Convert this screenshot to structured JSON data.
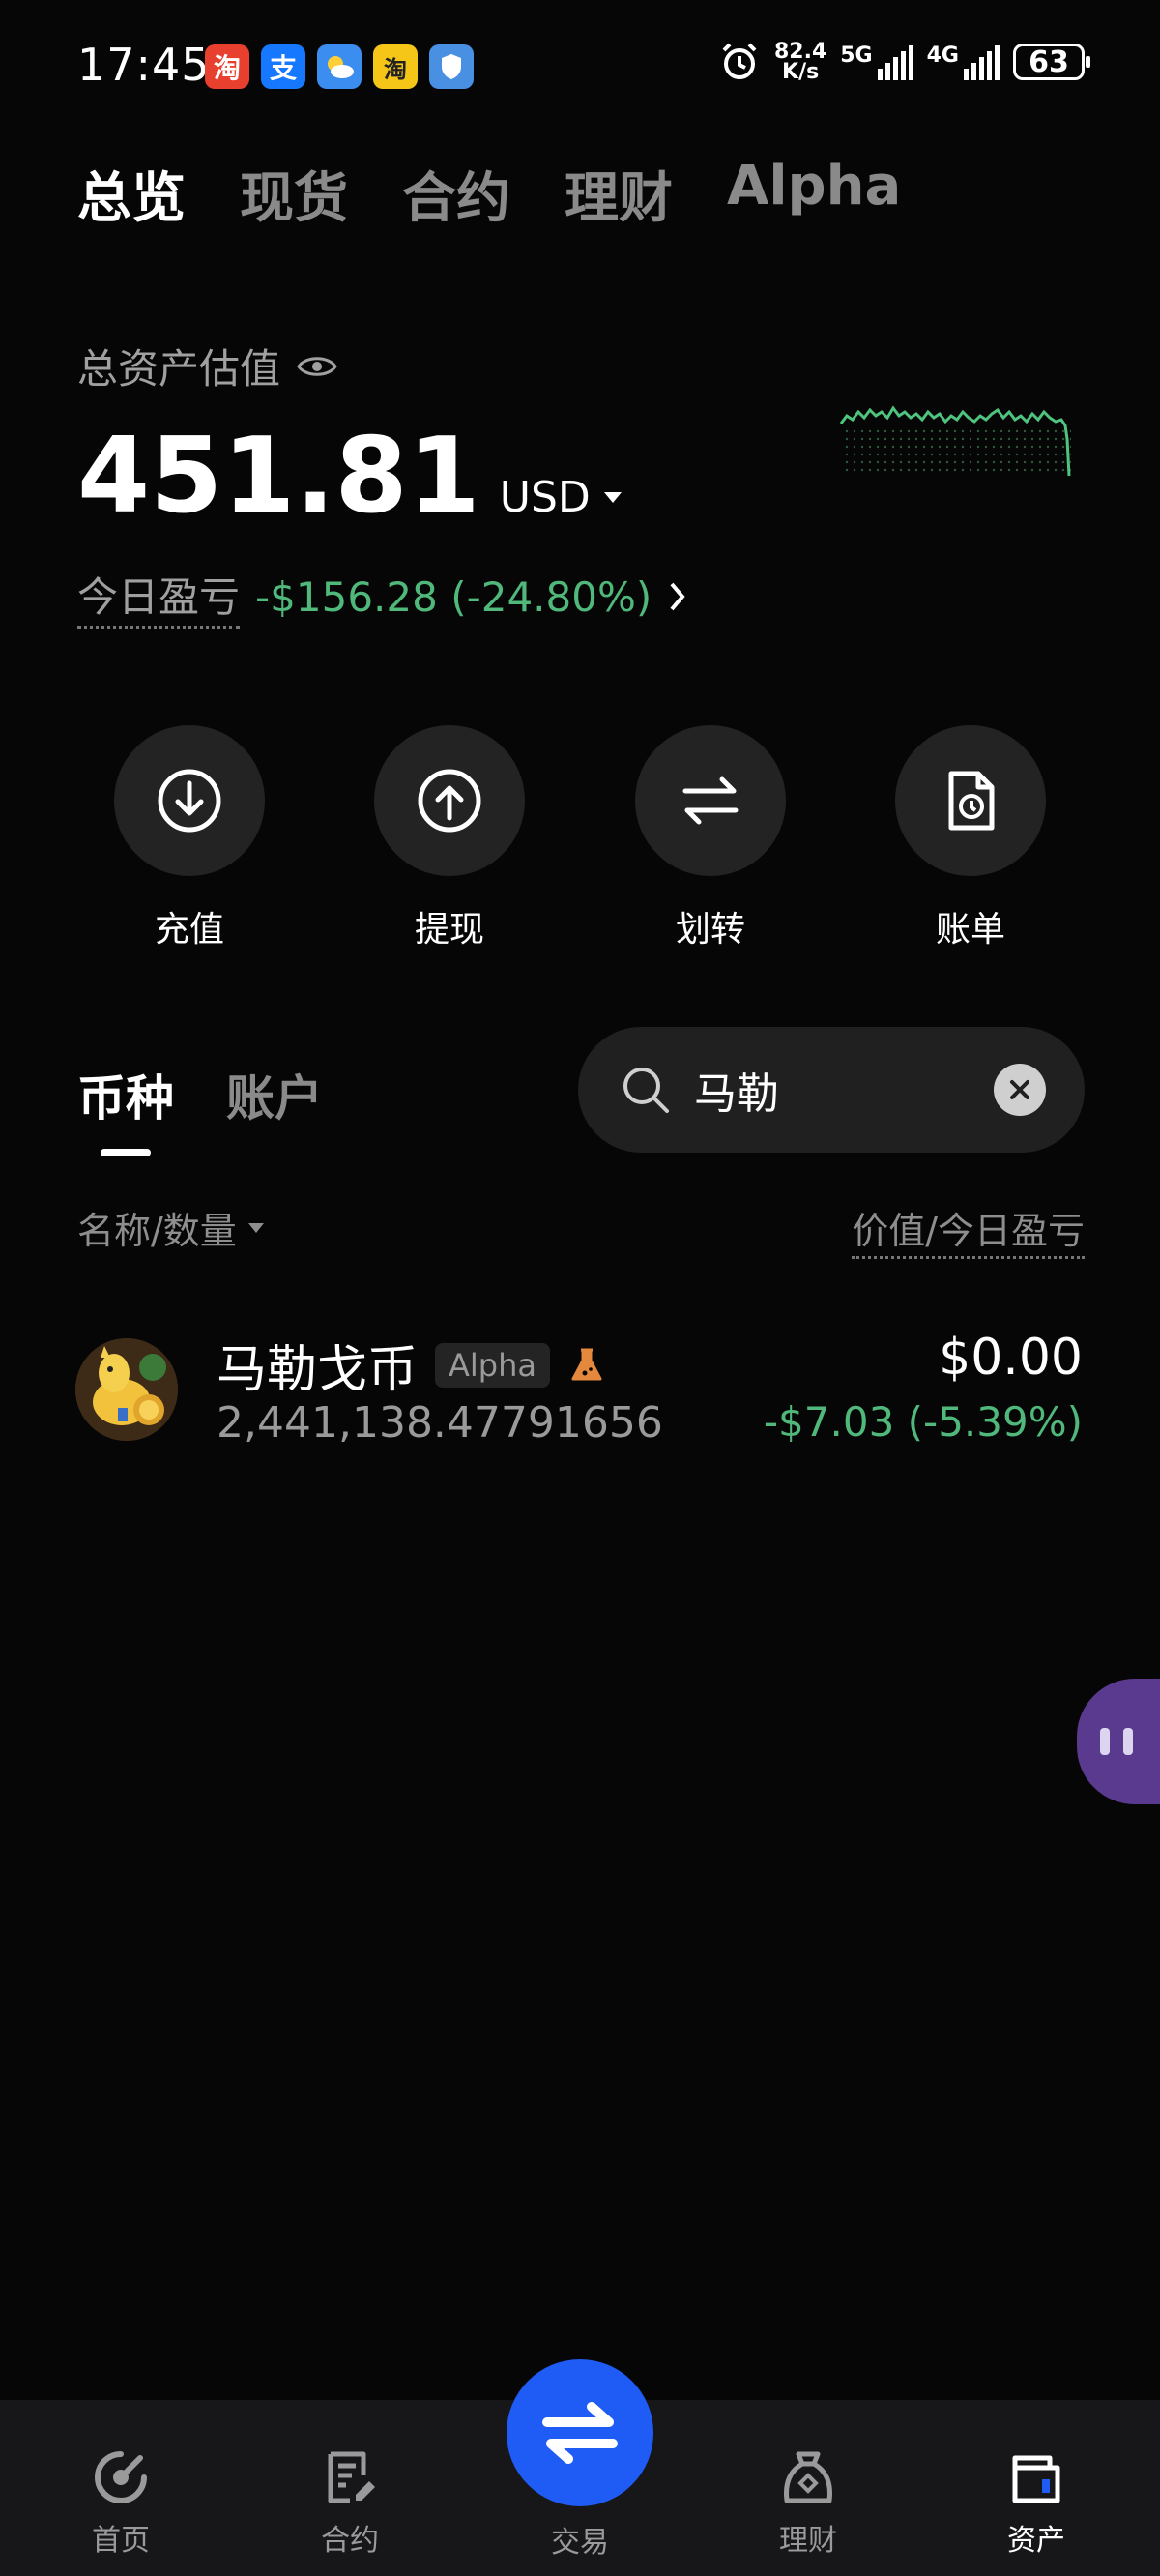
{
  "status_bar": {
    "time": "17:45",
    "net_speed_value": "82.4",
    "net_speed_unit": "K/s",
    "signal1_label": "5G",
    "signal2_label": "4G",
    "battery": "63"
  },
  "top_tabs": [
    {
      "label": "总览",
      "active": true
    },
    {
      "label": "现货",
      "active": false
    },
    {
      "label": "合约",
      "active": false
    },
    {
      "label": "理财",
      "active": false
    },
    {
      "label": "Alpha",
      "active": false
    }
  ],
  "assets": {
    "label": "总资产估值",
    "value": "451.81",
    "unit": "USD",
    "pnl_label": "今日盈亏",
    "pnl_value": "-$156.28 (-24.80%)"
  },
  "actions": [
    {
      "label": "充值",
      "icon": "deposit-icon"
    },
    {
      "label": "提现",
      "icon": "withdraw-icon"
    },
    {
      "label": "划转",
      "icon": "transfer-icon"
    },
    {
      "label": "账单",
      "icon": "bill-icon"
    }
  ],
  "list_tabs": [
    {
      "label": "币种",
      "active": true
    },
    {
      "label": "账户",
      "active": false
    }
  ],
  "search": {
    "value": "马勒"
  },
  "columns": {
    "left": "名称/数量",
    "right": "价值/今日盈亏"
  },
  "coins": [
    {
      "name": "马勒戈币",
      "tag": "Alpha",
      "amount": "2,441,138.47791656",
      "value": "$0.00",
      "pnl": "-$7.03 (-5.39%)"
    }
  ],
  "bottom_nav": {
    "home": "首页",
    "futures": "合约",
    "trade": "交易",
    "earn": "理财",
    "assets": "资产"
  },
  "colors": {
    "background": "#060606",
    "positive_green": "#4fb87a",
    "trade_blue": "#1f5cf5",
    "sparkline": "#4fc47f"
  }
}
